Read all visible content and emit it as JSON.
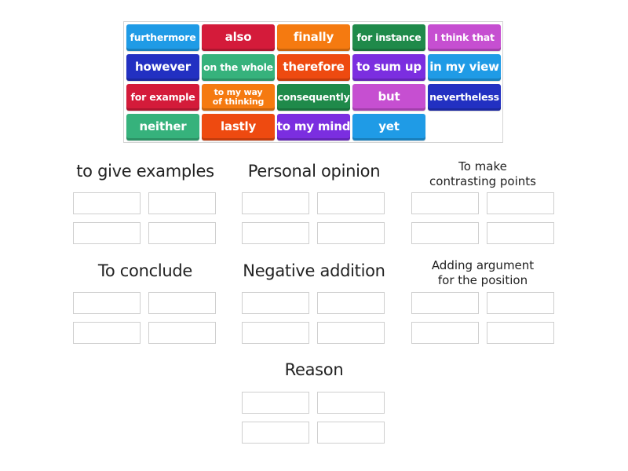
{
  "tiles": [
    {
      "label": "furthermore",
      "color": "#1f9be6"
    },
    {
      "label": "also",
      "color": "#d41b3a"
    },
    {
      "label": "finally",
      "color": "#f57a10"
    },
    {
      "label": "for instance",
      "color": "#1f8a4a"
    },
    {
      "label": "I think that",
      "color": "#c64fd1"
    },
    {
      "label": "however",
      "color": "#2230c2"
    },
    {
      "label": "on the whole",
      "color": "#36b27c"
    },
    {
      "label": "therefore",
      "color": "#ee4a10"
    },
    {
      "label": "to sum up",
      "color": "#7b2ee0"
    },
    {
      "label": "in my view",
      "color": "#1f9be6"
    },
    {
      "label": "for example",
      "color": "#d41b3a"
    },
    {
      "label": "to my way of thinking",
      "color": "#f57a10"
    },
    {
      "label": "consequently",
      "color": "#1f8a4a"
    },
    {
      "label": "but",
      "color": "#c64fd1"
    },
    {
      "label": "nevertheless",
      "color": "#2230c2"
    },
    {
      "label": "neither",
      "color": "#36b27c"
    },
    {
      "label": "lastly",
      "color": "#ee4a10"
    },
    {
      "label": "to my mind",
      "color": "#7b2ee0"
    },
    {
      "label": "yet",
      "color": "#1f9be6"
    }
  ],
  "groups": [
    {
      "title": "to give examples"
    },
    {
      "title": "Personal opinion"
    },
    {
      "title": "To make contrasting points",
      "line1": "To make",
      "line2": "contrasting points"
    },
    {
      "title": "To conclude"
    },
    {
      "title": "Negative addition"
    },
    {
      "title": "Adding argument for the position",
      "line1": "Adding argument",
      "line2": "for the position"
    },
    {
      "title": "Reason"
    }
  ]
}
